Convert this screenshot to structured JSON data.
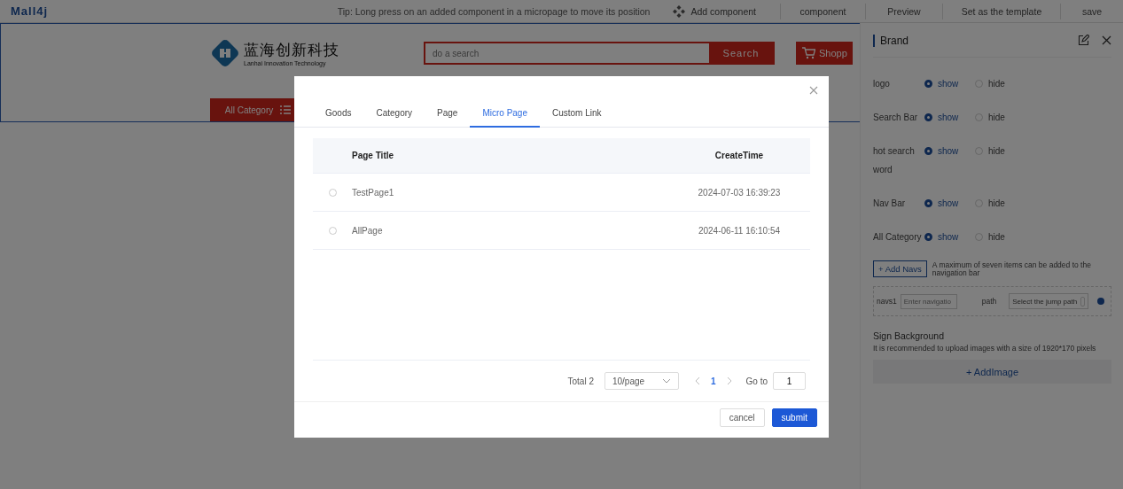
{
  "app": {
    "logo": "Mall4j"
  },
  "toolbar": {
    "tip": "Tip: Long press on an added component in a micropage to move its position",
    "add_component": "Add component",
    "actions": [
      "component",
      "Preview",
      "Set as the template",
      "save"
    ]
  },
  "store_header": {
    "brand_cn": "蓝海创新科技",
    "brand_en": "Lanhai Innovation Technology",
    "search_placeholder": "do a search",
    "search_button": "Search",
    "cart_button": "Shopp",
    "nav_category": "All Category"
  },
  "panel": {
    "title": "Brand",
    "options": [
      {
        "label": "logo",
        "choices": [
          {
            "label": "show",
            "selected": true
          },
          {
            "label": "hide",
            "selected": false
          }
        ]
      },
      {
        "label": "Search Bar",
        "choices": [
          {
            "label": "show",
            "selected": true
          },
          {
            "label": "hide",
            "selected": false
          }
        ]
      },
      {
        "label": "hot search word",
        "choices": [
          {
            "label": "show",
            "selected": true
          },
          {
            "label": "hide",
            "selected": false
          }
        ]
      },
      {
        "label": "Nav Bar",
        "choices": [
          {
            "label": "show",
            "selected": true
          },
          {
            "label": "hide",
            "selected": false
          }
        ]
      },
      {
        "label": "All Category",
        "choices": [
          {
            "label": "show",
            "selected": true
          },
          {
            "label": "hide",
            "selected": false
          }
        ]
      }
    ],
    "add_navs": "+ Add Navs",
    "add_navs_hint": "A maximum of seven items can be added to the navigation bar",
    "navs": [
      {
        "label": "navs1",
        "name_placeholder": "Enter navigatio",
        "path_label": "path",
        "path_placeholder": "Select the jump path"
      }
    ],
    "background_title": "Sign Background",
    "background_hint": "It is recommended to upload images with a size of 1920*170 pixels",
    "add_image": "+ AddImage"
  },
  "dialog": {
    "tabs": [
      {
        "label": "Goods",
        "selected": false
      },
      {
        "label": "Category",
        "selected": false
      },
      {
        "label": "Page",
        "selected": false
      },
      {
        "label": "Micro Page",
        "selected": true
      },
      {
        "label": "Custom Link",
        "selected": false
      }
    ],
    "table": {
      "columns": [
        "Page Title",
        "CreateTime"
      ],
      "rows": [
        {
          "selected": false,
          "title": "TestPage1",
          "time": "2024-07-03 16:39:23"
        },
        {
          "selected": false,
          "title": "AllPage",
          "time": "2024-06-11 16:10:54"
        }
      ]
    },
    "pagination": {
      "total": "Total 2",
      "page_size": "10/page",
      "pages": [
        {
          "label": "1",
          "selected": true
        }
      ],
      "goto_label": "Go to",
      "goto_value": "1"
    },
    "buttons": [
      {
        "label": "cancel",
        "kind": "default"
      },
      {
        "label": "submit",
        "kind": "primary"
      }
    ]
  }
}
